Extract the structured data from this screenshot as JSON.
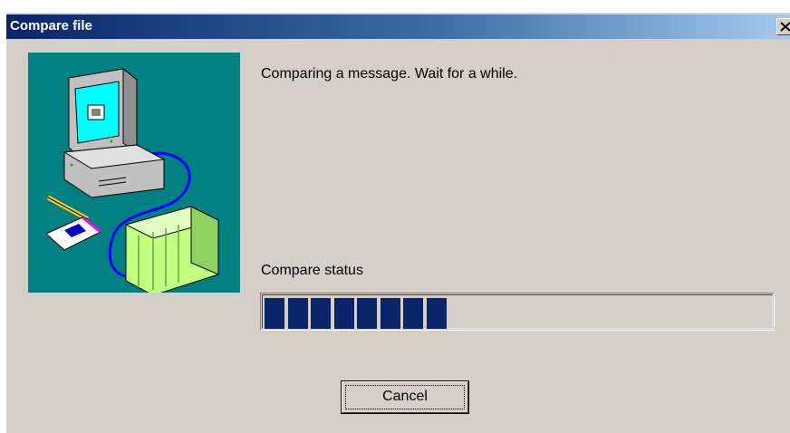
{
  "window": {
    "title": "Compare file",
    "close_label": "Close"
  },
  "illustration": {
    "icon": "computer-plc-connection-icon"
  },
  "message": "Comparing a message. Wait for a while.",
  "status": {
    "label": "Compare status",
    "progress_chunks_filled": 8,
    "progress_fraction": 0.36
  },
  "buttons": {
    "cancel_label": "Cancel"
  },
  "colors": {
    "title_start": "#0a246a",
    "title_end": "#a6caf0",
    "face": "#d4d0c8",
    "illustration_bg": "#008080",
    "progress_fill": "#0a246a"
  }
}
